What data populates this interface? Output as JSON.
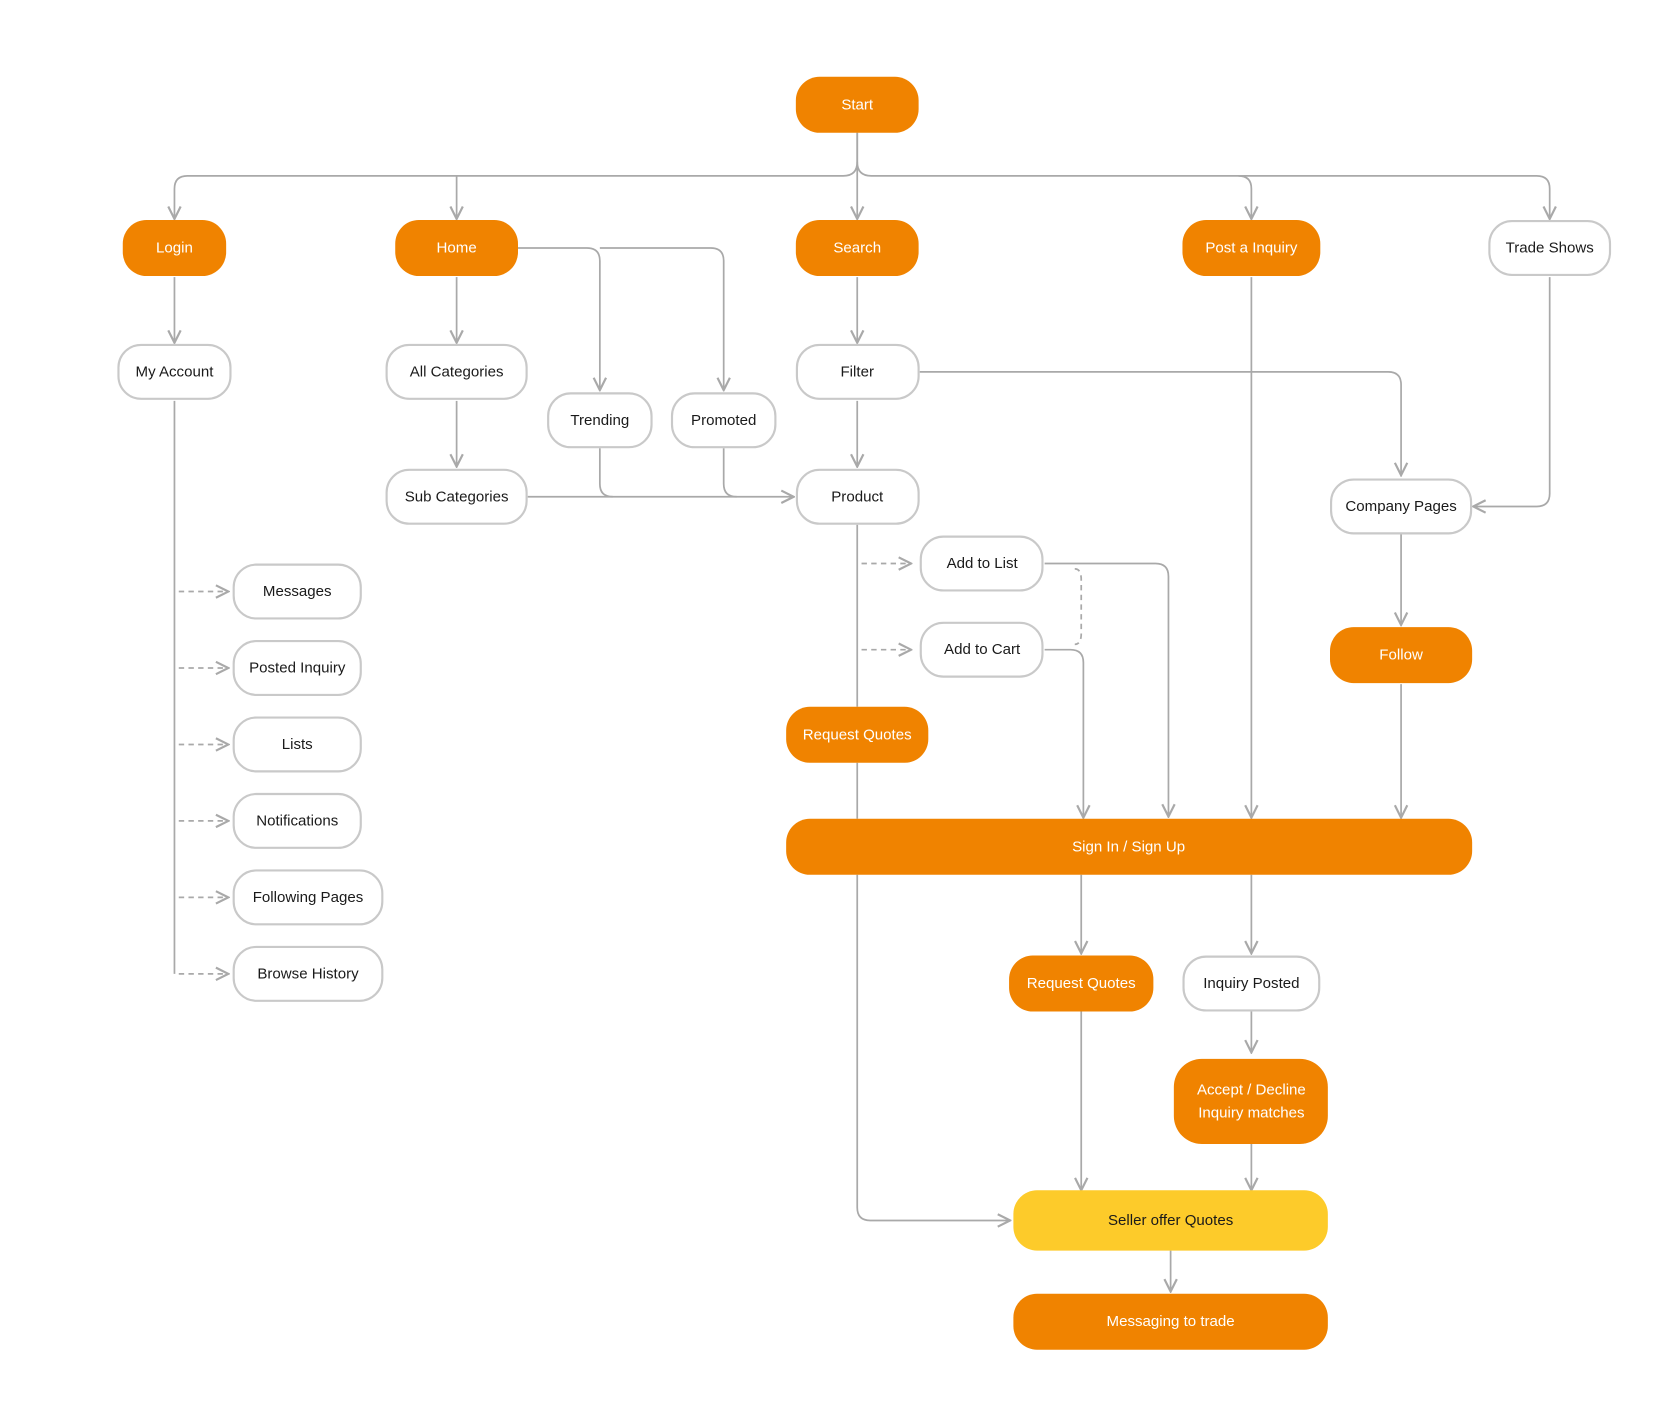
{
  "colors": {
    "primary": "#F08300",
    "highlight": "#FDCB2A",
    "connector": "#a9a9a9",
    "node_border": "#c9c9c9"
  },
  "nodes": {
    "start": "Start",
    "login": "Login",
    "home": "Home",
    "search": "Search",
    "post_inquiry": "Post a Inquiry",
    "trade_shows": "Trade Shows",
    "my_account": "My Account",
    "all_categories": "All Categories",
    "trending": "Trending",
    "promoted": "Promoted",
    "filter": "Filter",
    "sub_categories": "Sub Categories",
    "product": "Product",
    "company_pages": "Company Pages",
    "add_to_list": "Add to List",
    "add_to_cart": "Add to Cart",
    "follow": "Follow",
    "request_quotes": "Request Quotes",
    "sign_in": "Sign In / Sign Up",
    "messages": "Messages",
    "posted_inquiry": "Posted Inquiry",
    "lists": "Lists",
    "notifications": "Notifications",
    "following_pages": "Following Pages",
    "browse_history": "Browse History",
    "request_quotes_2": "Request Quotes",
    "inquiry_posted": "Inquiry Posted",
    "accept_decline_line1": "Accept / Decline",
    "accept_decline_line2": "Inquiry matches",
    "seller_offer_quotes": "Seller offer Quotes",
    "messaging_to_trade": "Messaging to trade"
  }
}
